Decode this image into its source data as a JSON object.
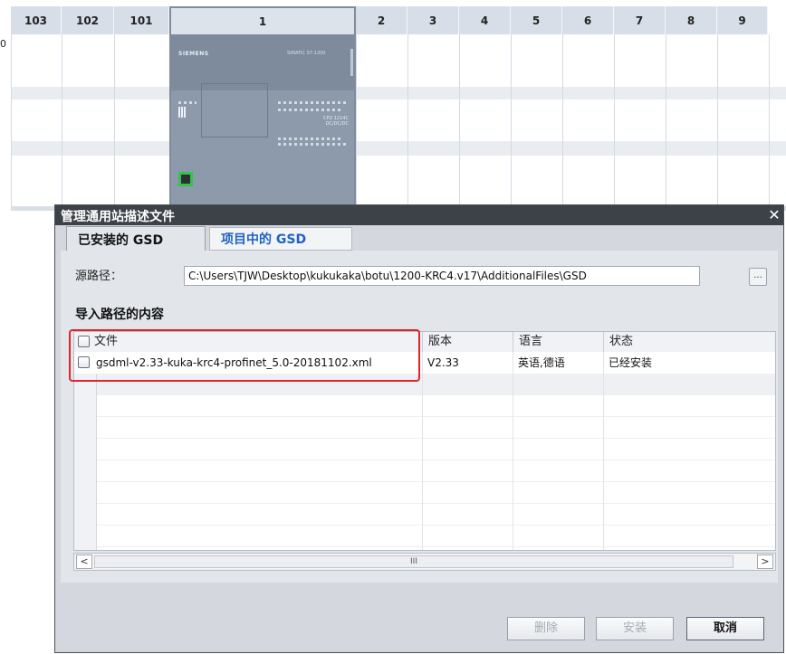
{
  "rack": {
    "slots": [
      "103",
      "102",
      "101",
      "1",
      "2",
      "3",
      "4",
      "5",
      "6",
      "7",
      "8",
      "9"
    ],
    "row_label": "0",
    "cpu": {
      "brand": "SIEMENS",
      "series": "SIMATIC S7-1200",
      "model_line1": "CPU 1214C",
      "model_line2": "DC/DC/DC"
    }
  },
  "dialog": {
    "title": "管理通用站描述文件",
    "close_icon": "close-icon",
    "tabs": [
      {
        "label": "已安装的 GSD",
        "active": true
      },
      {
        "label": "项目中的 GSD",
        "active": false
      }
    ],
    "source_label": "源路径：",
    "source_path": "C:\\Users\\TJW\\Desktop\\kukukaka\\botu\\1200-KRC4.v17\\AdditionalFiles\\GSD",
    "browse_label": "...",
    "section_title": "导入路径的内容",
    "table": {
      "columns": [
        "文件",
        "版本",
        "语言",
        "状态"
      ],
      "rows": [
        {
          "file": "gsdml-v2.33-kuka-krc4-profinet_5.0-20181102.xml",
          "version": "V2.33",
          "language": "英语,德语",
          "status": "已经安装"
        }
      ]
    },
    "scroll": {
      "left": "<",
      "right": ">",
      "thumb": "III"
    },
    "buttons": {
      "delete": "删除",
      "install": "安装",
      "cancel": "取消"
    },
    "colors": {
      "highlight": "#e0242a",
      "tab_inactive_text": "#1e62c8",
      "titlebar": "#3d4148"
    }
  }
}
